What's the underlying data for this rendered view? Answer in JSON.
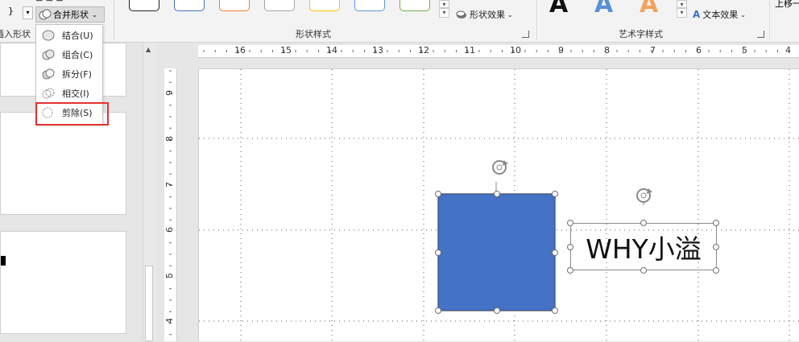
{
  "ribbon": {
    "insert_shapes_label": "插入形状",
    "merge_shapes_button": "合并形状",
    "shape_styles_label": "形状样式",
    "shape_effect_button": "形状效果",
    "wordart_styles_label": "艺术字样式",
    "text_effect_button": "文本效果",
    "move_up_button": "上移一"
  },
  "merge_menu": {
    "items": [
      {
        "label": "结合(U)"
      },
      {
        "label": "组合(C)"
      },
      {
        "label": "拆分(F)"
      },
      {
        "label": "相交(I)"
      },
      {
        "label": "剪除(S)"
      }
    ]
  },
  "ruler": {
    "horizontal_ticks": [
      "16",
      "15",
      "14",
      "13",
      "12",
      "11",
      "10",
      "9",
      "8",
      "7",
      "6",
      "5",
      "4"
    ],
    "vertical_ticks": [
      "9",
      "8",
      "7",
      "6",
      "5",
      "4"
    ]
  },
  "slide": {
    "textbox_text": "WHY小溢"
  },
  "colors": {
    "shape_fill": "#4472C4",
    "highlight": "#E2312F",
    "ribbon_bg": "#F3F3F3"
  }
}
